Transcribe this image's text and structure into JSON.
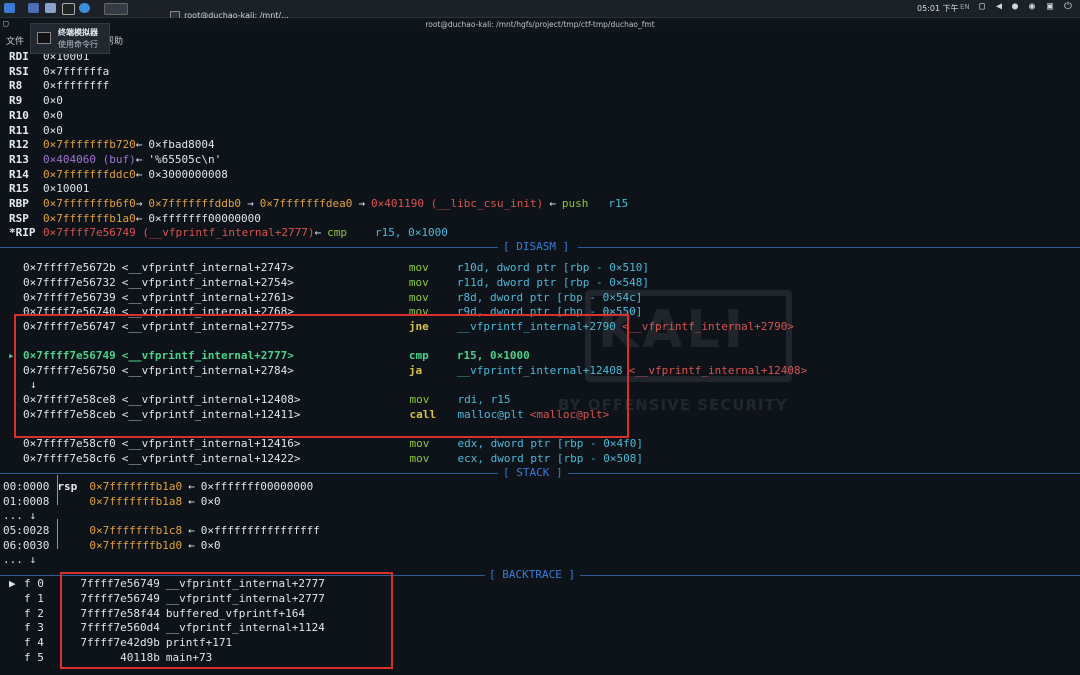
{
  "taskbar": {
    "active_window": "root@duchao-kali: /mnt/...",
    "clock": "05:01 下午",
    "lang": "EN"
  },
  "window": {
    "title": "root@duchao-kali: /mnt/hgfs/project/tmp/ctf-tmp/duchao_fmt"
  },
  "menu": {
    "file": "文件",
    "help": "帮助"
  },
  "tooltip": {
    "title": "终端模拟器",
    "subtitle": "使用命令行"
  },
  "registers": [
    {
      "name": "RDI",
      "val": "0×10001"
    },
    {
      "name": "RSI",
      "val": "0×7ffffffa"
    },
    {
      "name": "R8",
      "val": "0×ffffffff"
    },
    {
      "name": "R9",
      "val": "0×0"
    },
    {
      "name": "R10",
      "val": "0×0"
    },
    {
      "name": "R11",
      "val": "0×0"
    },
    {
      "name": "R12",
      "val": "0×7fffffffb720",
      "arrow": "←",
      "tail": "0×fbad8004"
    },
    {
      "name": "R13",
      "val": "0×404060 (buf)",
      "arrow": "←",
      "tail": "'%65505c\\n'"
    },
    {
      "name": "R14",
      "val": "0×7fffffffddc0",
      "arrow": "←",
      "tail": "0×3000000008"
    },
    {
      "name": "R15",
      "val": "0×10001"
    },
    {
      "name": "RBP",
      "val": "0×7fffffffb6f0",
      "arrow": "→",
      "c1": "0×7fffffffddb0",
      "c2": "0×7fffffffdea0",
      "c3": "0×401190 (__libc_csu_init)",
      "arrow2": "←",
      "op": "push",
      "arg": "r15"
    },
    {
      "name": "RSP",
      "val": "0×7fffffffb1a0",
      "arrow": "←",
      "tail": "0×fffffff00000000"
    },
    {
      "name": "*RIP",
      "val": "0×7ffff7e56749 (__vfprintf_internal+2777)",
      "arrow": "←",
      "op": "cmp",
      "arg": "r15, 0×1000"
    }
  ],
  "headers": {
    "disasm": "[ DISASM ]",
    "stack": "[ STACK ]",
    "backtrace": "[ BACKTRACE ]"
  },
  "disasm": [
    {
      "addr": "0×7ffff7e5672b",
      "sym": "<__vfprintf_internal+2747>",
      "op": "mov",
      "args": "r10d, dword ptr [rbp - 0×510]"
    },
    {
      "addr": "0×7ffff7e56732",
      "sym": "<__vfprintf_internal+2754>",
      "op": "mov",
      "args": "r11d, dword ptr [rbp - 0×548]"
    },
    {
      "addr": "0×7ffff7e56739",
      "sym": "<__vfprintf_internal+2761>",
      "op": "mov",
      "args": "r8d, dword ptr [rbp - 0×54c]"
    },
    {
      "addr": "0×7ffff7e56740",
      "sym": "<__vfprintf_internal+2768>",
      "op": "mov",
      "args": "r9d, dword ptr [rbp - 0×550]"
    },
    {
      "addr": "0×7ffff7e56747",
      "sym": "<__vfprintf_internal+2775>",
      "op": "jne",
      "args": "__vfprintf_internal+2790",
      "ref": "<__vfprintf_internal+2790>"
    },
    {
      "addr": "0×7ffff7e56749",
      "sym": "<__vfprintf_internal+2777>",
      "op": "cmp",
      "args": "r15, 0×1000"
    },
    {
      "addr": "0×7ffff7e56750",
      "sym": "<__vfprintf_internal+2784>",
      "op": "ja",
      "args": "__vfprintf_internal+12408",
      "ref": "<__vfprintf_internal+12408>"
    },
    {
      "addr": "0×7ffff7e58ce8",
      "sym": "<__vfprintf_internal+12408>",
      "op": "mov",
      "args": "rdi, r15"
    },
    {
      "addr": "0×7ffff7e58ceb",
      "sym": "<__vfprintf_internal+12411>",
      "op": "call",
      "args": "malloc@plt",
      "ref": "<malloc@plt>"
    },
    {
      "addr": "0×7ffff7e58cf0",
      "sym": "<__vfprintf_internal+12416>",
      "op": "mov",
      "args": "edx, dword ptr [rbp - 0×4f0]"
    },
    {
      "addr": "0×7ffff7e58cf6",
      "sym": "<__vfprintf_internal+12422>",
      "op": "mov",
      "args": "ecx, dword ptr [rbp - 0×508]"
    }
  ],
  "stack": [
    {
      "off": "00:0000",
      "reg": "rsp",
      "addr": "0×7fffffffb1a0",
      "val": "0×fffffff00000000"
    },
    {
      "off": "01:0008",
      "reg": "",
      "addr": "0×7fffffffb1a8",
      "val": "0×0"
    },
    {
      "off": "05:0028",
      "reg": "",
      "addr": "0×7fffffffb1c8",
      "val": "0×ffffffffffffffff"
    },
    {
      "off": "06:0030",
      "reg": "",
      "addr": "0×7fffffffb1d0",
      "val": "0×0"
    }
  ],
  "backtrace": [
    {
      "frame": "f 0",
      "addr": "7ffff7e56749",
      "func": "__vfprintf_internal+2777"
    },
    {
      "frame": "f 1",
      "addr": "7ffff7e56749",
      "func": "__vfprintf_internal+2777"
    },
    {
      "frame": "f 2",
      "addr": "7ffff7e58f44",
      "func": "buffered_vfprintf+164"
    },
    {
      "frame": "f 3",
      "addr": "7ffff7e560d4",
      "func": "__vfprintf_internal+1124"
    },
    {
      "frame": "f 4",
      "addr": "7ffff7e42d9b",
      "func": "printf+171"
    },
    {
      "frame": "f 5",
      "addr": "40118b",
      "func": "main+73"
    }
  ],
  "watermark": {
    "logo": "KALI",
    "slogan": "BY OFFENSIVE SECURITY"
  }
}
